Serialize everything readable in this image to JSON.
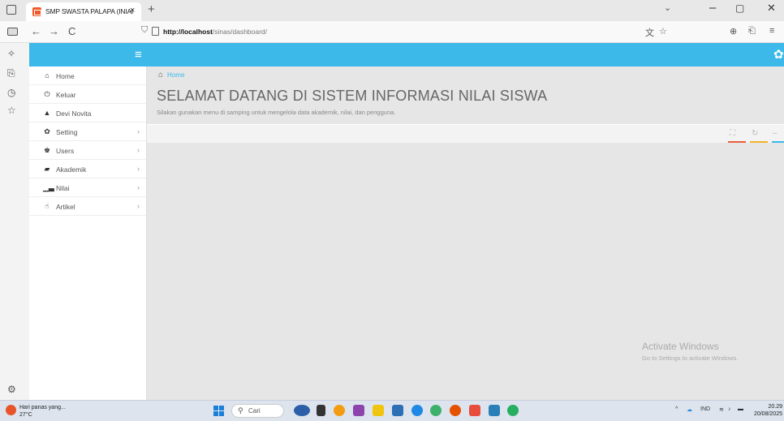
{
  "browser": {
    "tab_title": "SMP SWASTA PALAPA (INIAI",
    "tab_close": "×",
    "new_tab": "+",
    "url_host": "http://localhost",
    "url_path": "/sinas/dashboard/",
    "back": "←",
    "forward": "→",
    "reload": "C"
  },
  "app": {
    "menu_icon": "hamburger-icon",
    "settings_icon": "gear-icon",
    "nav": [
      {
        "label": "Home",
        "icon": "home-icon",
        "glyph": "⌂",
        "arrow": ""
      },
      {
        "label": "Keluar",
        "icon": "power-icon",
        "glyph": "⏻",
        "arrow": ""
      },
      {
        "label": "Devi Novita",
        "icon": "user-icon",
        "glyph": "▲",
        "arrow": ""
      },
      {
        "label": "Setting",
        "icon": "gear-icon",
        "glyph": "✿",
        "arrow": "›"
      },
      {
        "label": "Users",
        "icon": "users-icon",
        "glyph": "♚",
        "arrow": "›"
      },
      {
        "label": "Akademik",
        "icon": "book-icon",
        "glyph": "▰",
        "arrow": "›"
      },
      {
        "label": "Nilai",
        "icon": "bar-chart-icon",
        "glyph": "▁▃",
        "arrow": "›"
      },
      {
        "label": "Artikel",
        "icon": "thumbs-up-icon",
        "glyph": "☝",
        "arrow": "›"
      }
    ],
    "breadcrumb": "Home",
    "heading": "SELAMAT DATANG DI SISTEM INFORMASI NILAI SISWA",
    "subtext": "Silakan gunakan menu di samping untuk mengelola data akademik, nilai, dan pengguna.",
    "activate_title": "Activate Windows",
    "activate_sub": "Go to Settings to activate Windows."
  },
  "taskbar": {
    "weather_title": "Hari panas yang...",
    "weather_temp": "27°C",
    "search_label": "Cari",
    "lang": "IND",
    "time": "20.29",
    "date": "20/08/2025"
  },
  "colors": {
    "accent": "#3cb9e8",
    "tab_favicon": "#f05a28"
  }
}
